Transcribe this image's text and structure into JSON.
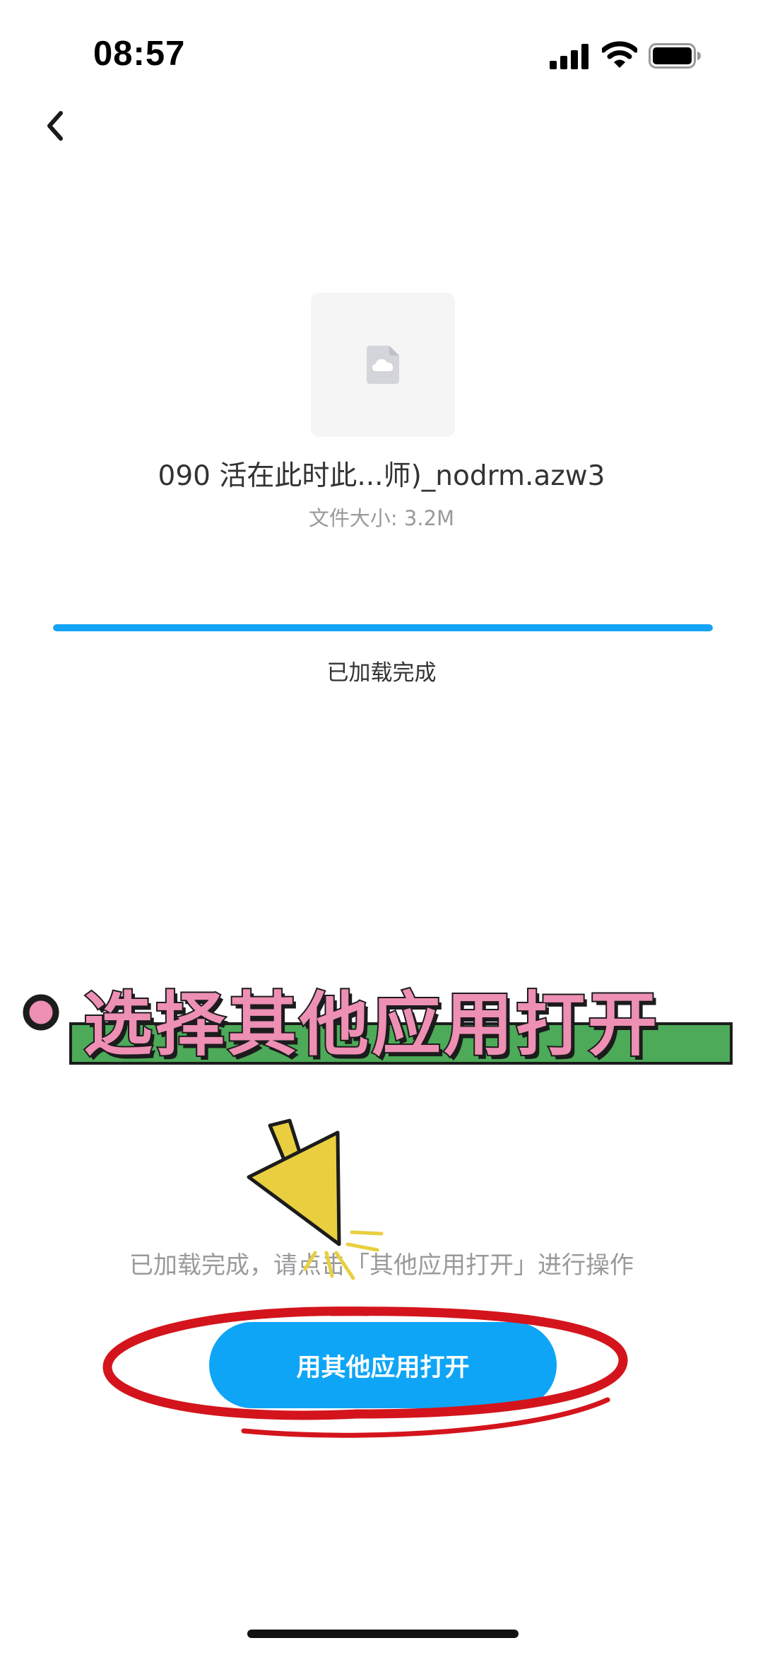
{
  "status_bar": {
    "time": "08:57",
    "icons": [
      "signal-icon",
      "wifi-icon",
      "battery-icon"
    ]
  },
  "nav": {
    "back_icon": "chevron-left-icon"
  },
  "file": {
    "icon": "cloud-file-icon",
    "name": "090 活在此时此...师)_nodrm.azw3",
    "size_text": "文件大小: 3.2M"
  },
  "progress": {
    "fraction": 1.0,
    "status_text": "已加载完成",
    "color": "#14a3f5"
  },
  "annotation": {
    "banner_text": "选择其他应用打开",
    "banner_colors": {
      "text": "#ee8fb4",
      "band": "#4caa58",
      "outline": "#1c1c1c"
    },
    "arrow_color": "#e9cf3f",
    "circle_color": "#d4141c"
  },
  "hint_text": "已加载完成，请点击「其他应用打开」进行操作",
  "open_button": {
    "label": "用其他应用打开",
    "color": "#0ea5f6"
  }
}
